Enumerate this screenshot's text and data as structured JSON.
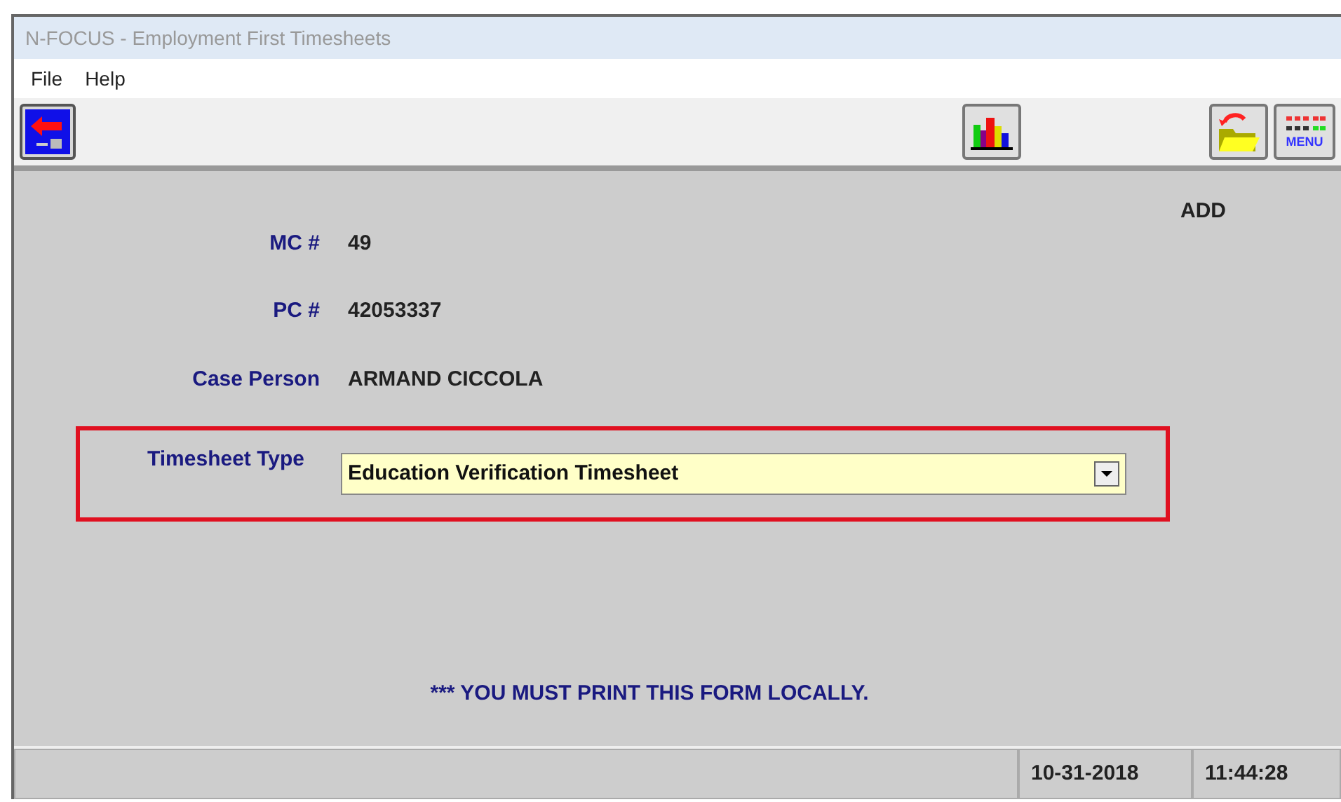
{
  "window": {
    "title": "N-FOCUS - Employment First Timesheets"
  },
  "menu": [
    "File",
    "Help"
  ],
  "toolbar": {
    "menu_button_label": "MENU"
  },
  "mode": "ADD",
  "fields": [
    {
      "label": "MC #",
      "value": "49"
    },
    {
      "label": "PC #",
      "value": "42053337"
    },
    {
      "label": "Case Person",
      "value": "ARMAND CICCOLA"
    }
  ],
  "timesheet_type": {
    "label": "Timesheet Type",
    "value": "Education Verification Timesheet",
    "highlighted": true
  },
  "notice": "*** YOU MUST PRINT THIS FORM LOCALLY.",
  "status_bar": {
    "date": "10-31-2018",
    "time": "11:44:28"
  }
}
